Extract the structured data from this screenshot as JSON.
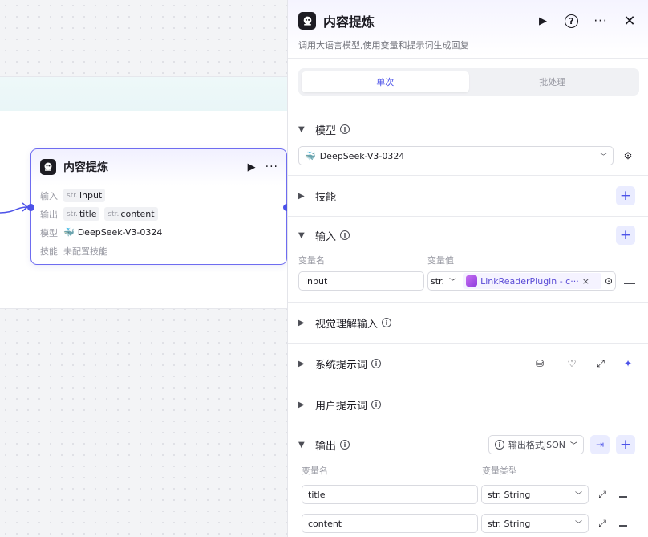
{
  "node": {
    "title": "内容提炼",
    "rows": {
      "input_label": "输入",
      "input_tag_type": "str.",
      "input_tag_name": "input",
      "output_label": "输出",
      "output_tags": [
        {
          "type": "str.",
          "name": "title"
        },
        {
          "type": "str.",
          "name": "content"
        }
      ],
      "model_label": "模型",
      "model_value": "DeepSeek-V3-0324",
      "skill_label": "技能",
      "skill_value": "未配置技能"
    }
  },
  "panel": {
    "title": "内容提炼",
    "description": "调用大语言模型,使用变量和提示词生成回复",
    "tabs": [
      "单次",
      "批处理"
    ],
    "active_tab": "单次",
    "sections": {
      "model": {
        "label": "模型",
        "selected": "DeepSeek-V3-0324"
      },
      "skills": {
        "label": "技能"
      },
      "input": {
        "label": "输入",
        "col_name": "变量名",
        "col_value": "变量值",
        "row": {
          "name": "input",
          "type": "str.",
          "plugin": "LinkReaderPlugin - c···"
        }
      },
      "vision": {
        "label": "视觉理解输入"
      },
      "system_prompt": {
        "label": "系统提示词"
      },
      "user_prompt": {
        "label": "用户提示词"
      },
      "output": {
        "label": "输出",
        "format_label": "输出格式JSON",
        "col_name": "变量名",
        "col_type": "变量类型",
        "rows": [
          {
            "name": "title",
            "type": "str. String"
          },
          {
            "name": "content",
            "type": "str. String"
          }
        ]
      }
    }
  },
  "colors": {
    "accent": "#4d53e8",
    "node_border": "#6e6cf0",
    "plugin": "#8f3dde"
  }
}
